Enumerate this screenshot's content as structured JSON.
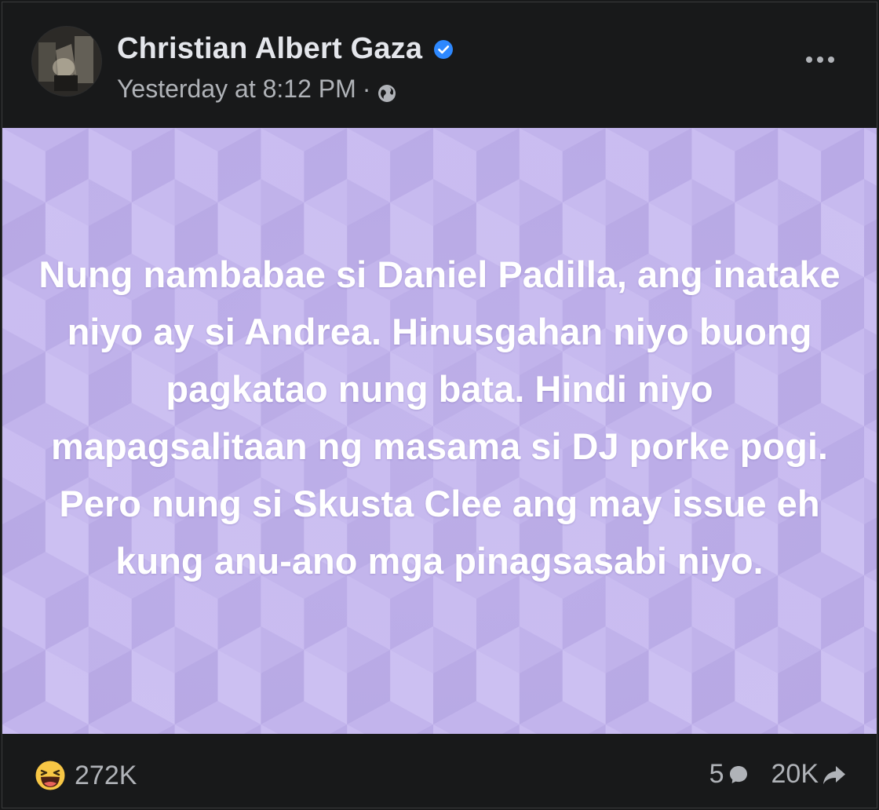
{
  "post": {
    "author": {
      "name": "Christian Albert Gaza",
      "verified_icon": "verified-badge-icon"
    },
    "meta": {
      "timestamp": "Yesterday at 8:12 PM",
      "separator": "·",
      "audience_icon": "globe-icon"
    },
    "menu_icon": "more-options-icon",
    "body": {
      "text": "Nung nambabae si Daniel Padilla, ang inatake niyo ay si Andrea. Hinusgahan niyo buong pagkatao nung bata. Hindi niyo mapagsalitaan ng masama si DJ porke pogi. Pero nung si Skusta Clee ang may issue eh kung anu-ano mga pinagsasabi niyo.",
      "background_color": "#c3b5ec",
      "text_color": "#ffffff"
    },
    "stats": {
      "reaction_icon": "haha-reaction-icon",
      "reaction_count": "272K",
      "comment_count": "5",
      "comment_icon": "comment-icon",
      "share_count": "20K",
      "share_icon": "share-icon"
    }
  },
  "colors": {
    "background": "#18191a",
    "primary_text": "#e4e6eb",
    "secondary_text": "#b0b3b8",
    "verified_blue": "#2d88ff"
  }
}
